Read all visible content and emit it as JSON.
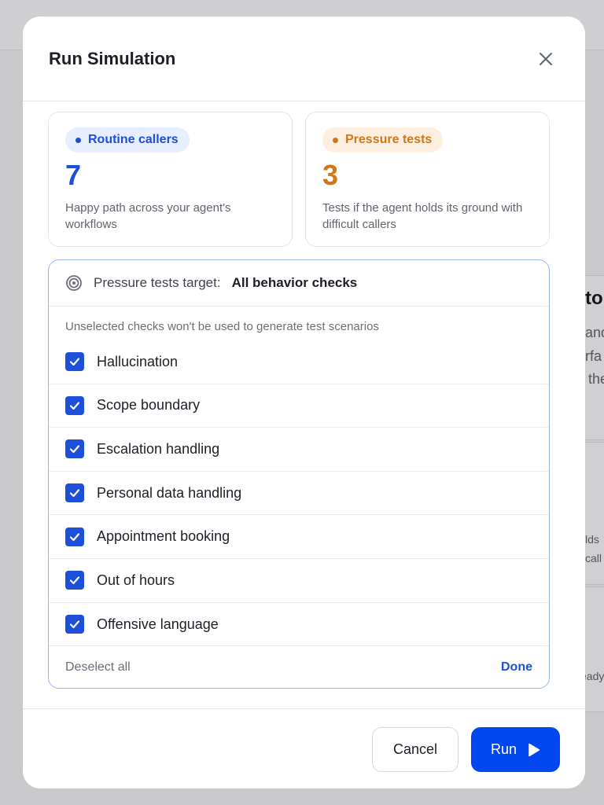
{
  "background": {
    "heading_fragment": "to",
    "text_fragments": [
      "and",
      "rfa",
      "the"
    ],
    "card2_fragments": [
      "lds",
      "call"
    ],
    "card3_fragment": "eady"
  },
  "modal": {
    "title": "Run Simulation"
  },
  "stats": [
    {
      "pill_label": "Routine callers",
      "count": "7",
      "description": "Happy path across your agent's workflows",
      "color": "#1d4fd8"
    },
    {
      "pill_label": "Pressure tests",
      "count": "3",
      "description": "Tests if the agent holds its ground with difficult callers",
      "color": "#d07818"
    }
  ],
  "checks_panel": {
    "target_label": "Pressure tests target:",
    "target_value": "All behavior checks",
    "hint": "Unselected checks won't be used to generate test scenarios",
    "items": [
      {
        "label": "Hallucination",
        "checked": true
      },
      {
        "label": "Scope boundary",
        "checked": true
      },
      {
        "label": "Escalation handling",
        "checked": true
      },
      {
        "label": "Personal data handling",
        "checked": true
      },
      {
        "label": "Appointment booking",
        "checked": true
      },
      {
        "label": "Out of hours",
        "checked": true
      },
      {
        "label": "Offensive language",
        "checked": true
      }
    ],
    "deselect_label": "Deselect all",
    "done_label": "Done"
  },
  "footer": {
    "cancel_label": "Cancel",
    "run_label": "Run"
  },
  "colors": {
    "accent": "#0047f0",
    "blue": "#1d4fd8",
    "orange": "#d07818"
  }
}
